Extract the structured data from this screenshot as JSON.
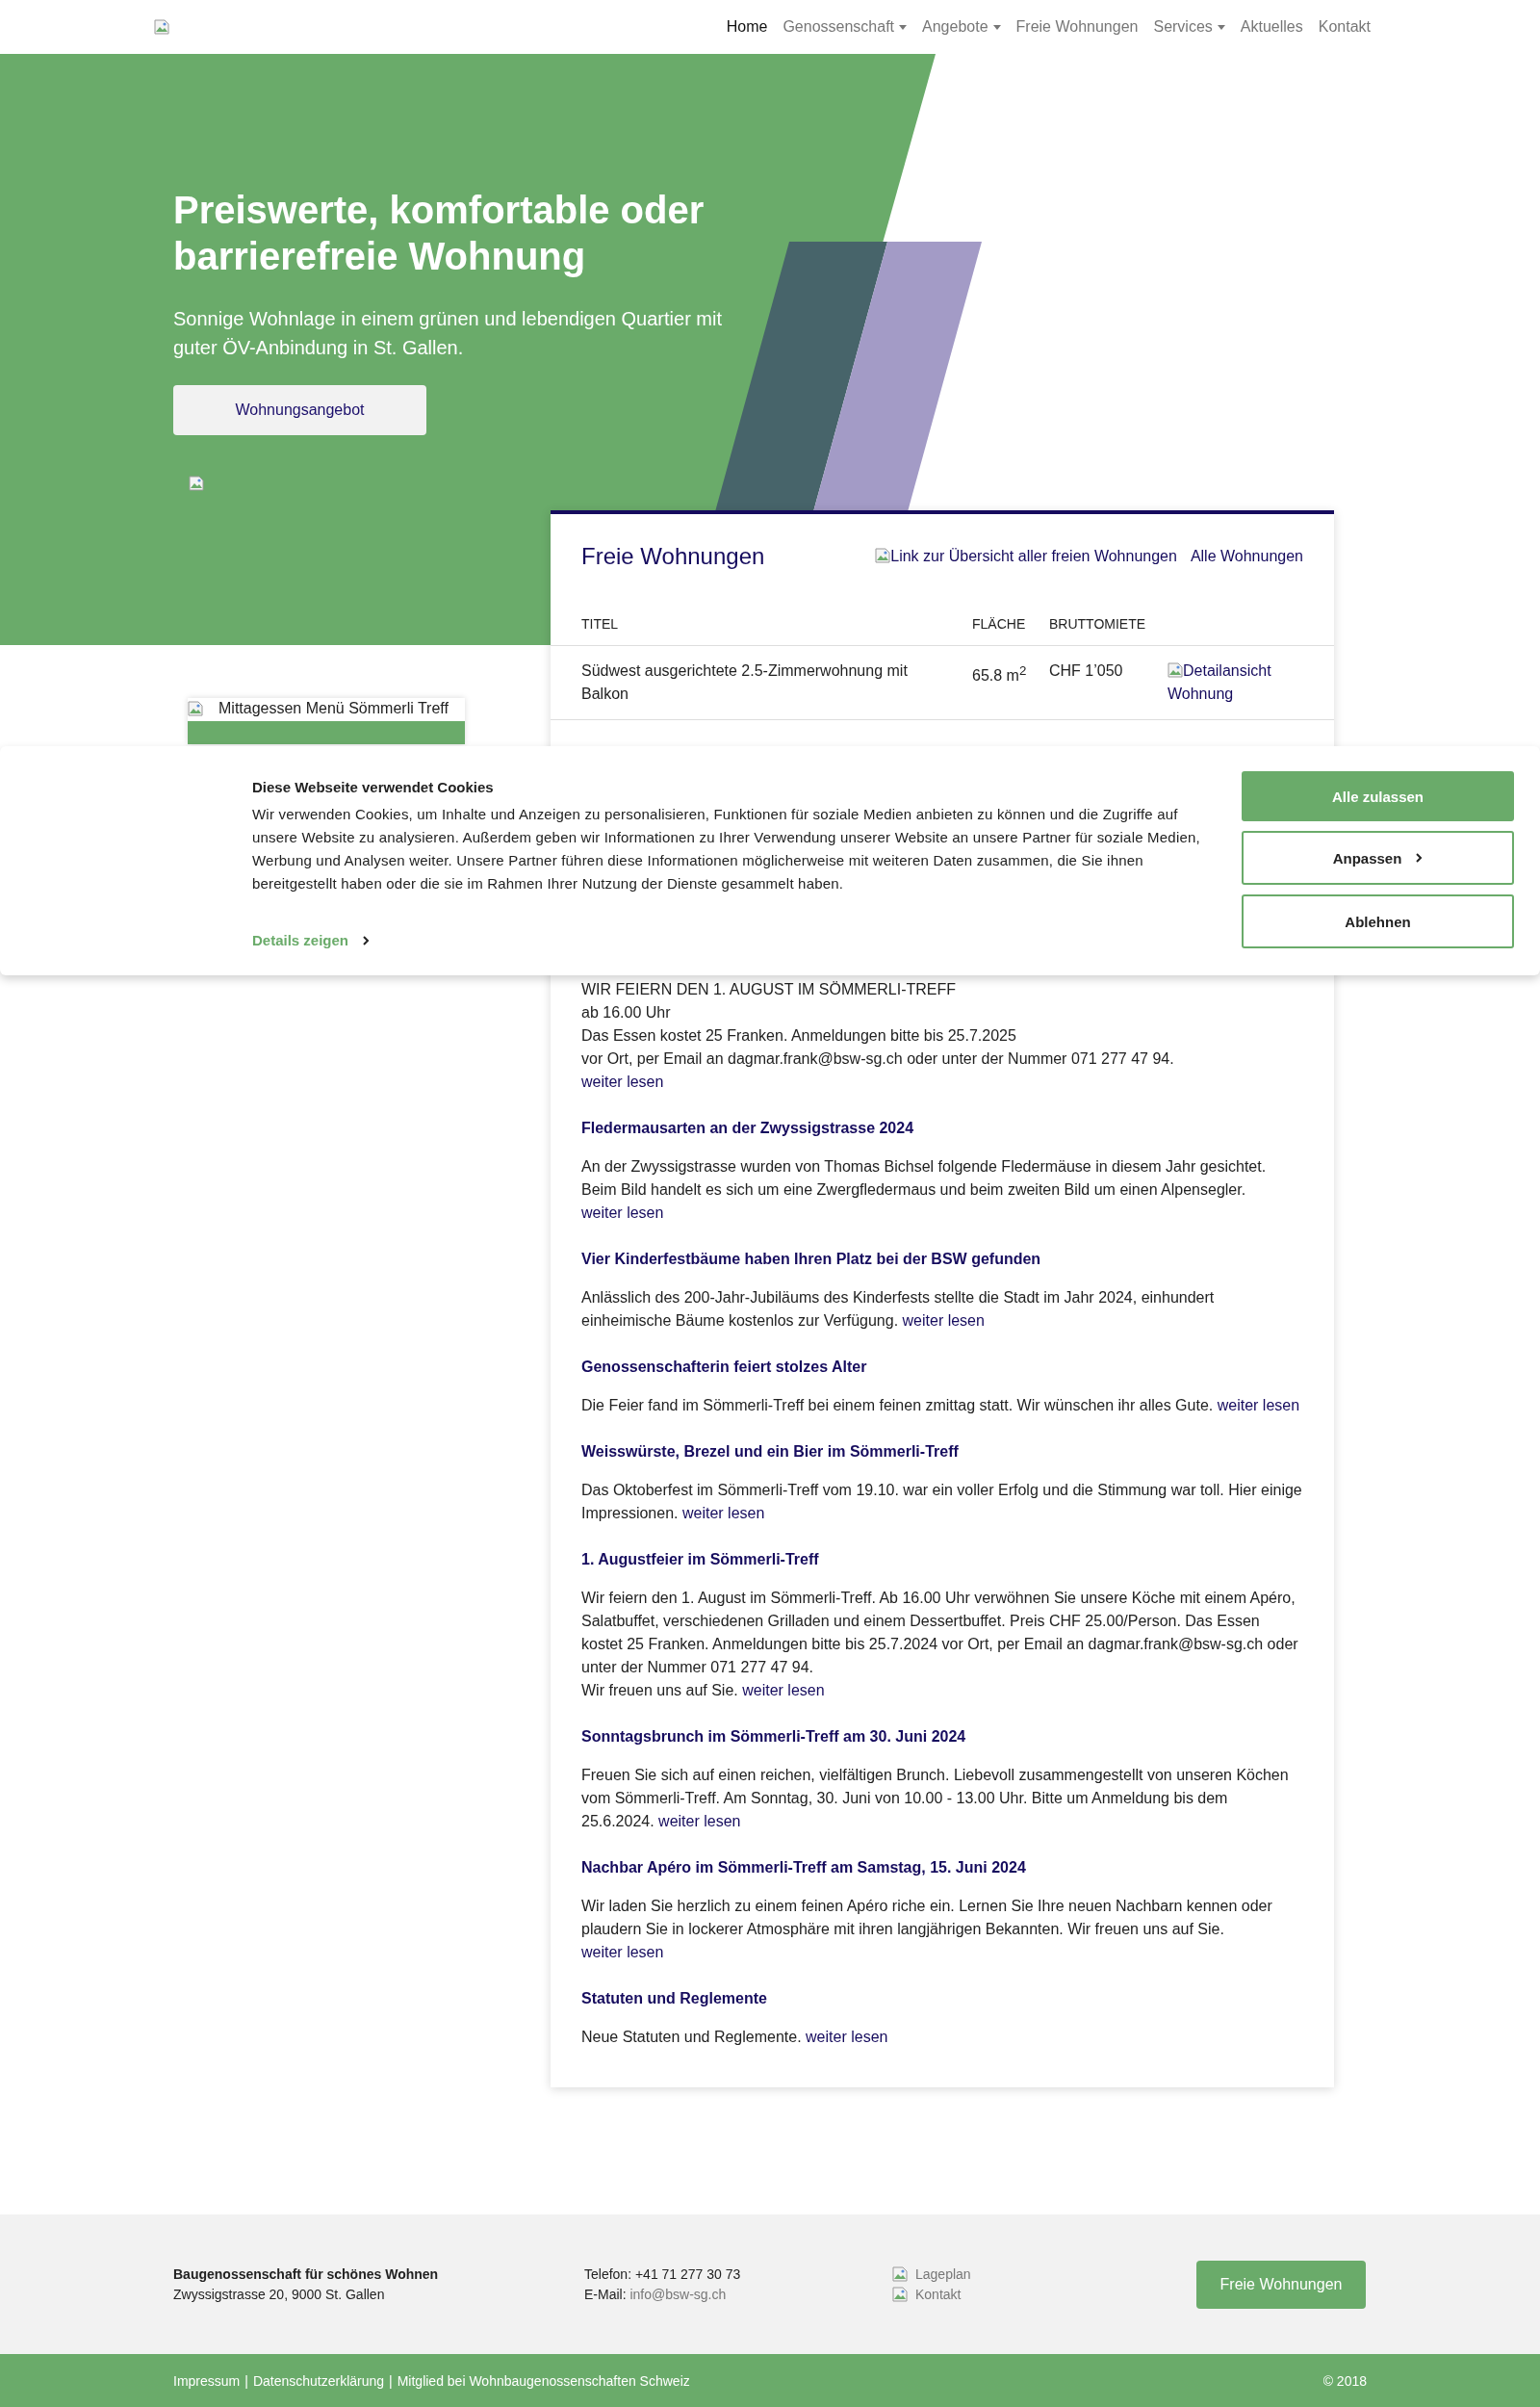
{
  "nav": {
    "items": [
      {
        "label": "Home",
        "selected": true,
        "dropdown": false
      },
      {
        "label": "Genossenschaft",
        "selected": false,
        "dropdown": true
      },
      {
        "label": "Angebote",
        "selected": false,
        "dropdown": true
      },
      {
        "label": "Freie Wohnungen",
        "selected": false,
        "dropdown": false
      },
      {
        "label": "Services",
        "selected": false,
        "dropdown": true
      },
      {
        "label": "Aktuelles",
        "selected": false,
        "dropdown": false
      },
      {
        "label": "Kontakt",
        "selected": false,
        "dropdown": false
      }
    ]
  },
  "hero": {
    "title": "Preiswerte, komfortable oder barrierefreie Wohnung",
    "subtitle": "Sonnige Wohnlage in einem grünen und lebendigen Quartier mit guter ÖV-Anbindung in St. Gallen.",
    "button": "Wohnungsangebot"
  },
  "side_card": {
    "image_alt": "Mittagessen Menü Sömmerli Treff"
  },
  "apartments": {
    "title": "Freie Wohnungen",
    "overview_image_alt": "Link zur Übersicht aller freien Wohnungen",
    "overview_link": "Alle Wohnungen",
    "columns": [
      "TITEL",
      "FLÄCHE",
      "BRUTTOMIETE"
    ],
    "rows": [
      {
        "title": "Südwest ausgerichtete 2.5-Zimmerwohnung mit Balkon",
        "area": "65.8 m$^{2}$",
        "rent": "CHF 1’050",
        "detail_image_alt": "Detailansicht Wohnung"
      }
    ]
  },
  "news": [
    {
      "lines": [
        "WIR FEIERN DEN 1. AUGUST IM SÖMMERLI-TREFF",
        "ab 16.00 Uhr",
        "Das Essen kostet 25 Franken. Anmeldungen bitte bis 25.7.2025",
        "vor Ort, per Email an dagmar.frank@bsw-sg.ch oder unter der Nummer 071 277 47 94."
      ],
      "link": "weiter lesen",
      "kind": "notice"
    },
    {
      "title": "Fledermausarten an der Zwyssigstrasse 2024",
      "lines": [
        "An der Zwyssigstrasse wurden von Thomas Bichsel folgende Fledermäuse in diesem Jahr gesichtet. Beim Bild handelt es sich um eine Zwergfledermaus und beim zweiten Bild um einen Alpensegler."
      ],
      "link": "weiter lesen",
      "kind": "article"
    },
    {
      "title": "Vier Kinderfestbäume haben Ihren Platz bei der BSW gefunden",
      "lines": [
        "Anlässlich des 200-Jahr-Jubiläums des Kinderfests stellte die Stadt im Jahr 2024, einhundert einheimische Bäume kostenlos zur Verfügung."
      ],
      "link": "weiter lesen",
      "kind": "article"
    },
    {
      "title": "Genossenschafterin feiert stolzes Alter",
      "lines": [
        "Die Feier fand im Sömmerli-Treff bei einem feinen zmittag statt. Wir wünschen ihr alles Gute."
      ],
      "link": "weiter lesen",
      "kind": "article"
    },
    {
      "title": "Weisswürste, Brezel und ein Bier im Sömmerli-Treff",
      "lines": [
        "Das Oktoberfest im Sömmerli-Treff vom 19.10. war ein voller Erfolg und die Stimmung war toll. Hier einige Impressionen."
      ],
      "link": "weiter lesen",
      "kind": "article"
    },
    {
      "title": "1. Augustfeier im Sömmerli-Treff",
      "lines": [
        "Wir feiern den 1. August im Sömmerli-Treff. Ab 16.00 Uhr verwöhnen Sie unsere Köche mit einem Apéro, Salatbuffet, verschiedenen Grilladen und einem Dessertbuffet. Preis CHF 25.00/Person. Das Essen kostet 25 Franken. Anmeldungen bitte bis 25.7.2024 vor Ort, per Email an dagmar.frank@bsw-sg.ch oder unter der Nummer 071 277 47 94.",
        "Wir freuen uns auf Sie."
      ],
      "link": "weiter lesen",
      "kind": "article"
    },
    {
      "title": "Sonntagsbrunch im Sömmerli-Treff am 30. Juni 2024",
      "lines": [
        "Freuen Sie sich auf einen reichen, vielfältigen Brunch. Liebevoll zusammengestellt von unseren Köchen vom Sömmerli-Treff. Am Sonntag, 30. Juni von 10.00 - 13.00 Uhr. Bitte um Anmeldung bis dem 25.6.2024."
      ],
      "link": "weiter lesen",
      "kind": "article"
    },
    {
      "title": "Nachbar Apéro im Sömmerli-Treff am Samstag, 15. Juni 2024",
      "lines": [
        "Wir laden Sie herzlich zu einem feinen Apéro riche ein. Lernen Sie Ihre neuen Nachbarn kennen oder plaudern Sie in lockerer Atmosphäre mit ihren langjährigen Bekannten. Wir freuen uns auf Sie."
      ],
      "link": "weiter lesen",
      "kind": "article"
    },
    {
      "title": "Statuten und Reglemente",
      "lines": [
        "Neue Statuten und Reglemente."
      ],
      "link": "weiter lesen",
      "kind": "article"
    }
  ],
  "cookie_banner": {
    "title": "Diese Webseite verwendet Cookies",
    "text": "Wir verwenden Cookies, um Inhalte und Anzeigen zu personalisieren, Funktionen für soziale Medien anbieten zu können und die Zugriffe auf unsere Website zu analysieren. Außerdem geben wir Informationen zu Ihrer Verwendung unserer Website an unsere Partner für soziale Medien, Werbung und Analysen weiter. Unsere Partner führen diese Informationen möglicherweise mit weiteren Daten zusammen, die Sie ihnen bereitgestellt haben oder die sie im Rahmen Ihrer Nutzung der Dienste gesammelt haben.",
    "details_link": "Details zeigen",
    "buttons": [
      {
        "label": "Alle zulassen",
        "kind": "primary"
      },
      {
        "label": "Anpassen",
        "kind": "chevron"
      },
      {
        "label": "Ablehnen",
        "kind": "outline"
      }
    ]
  },
  "footer": {
    "org_name": "Baugenossenschaft für schönes Wohnen",
    "address": "Zwyssigstrasse 20, 9000 St. Gallen",
    "phone": "Telefon: +41 71 277 30 73",
    "email_label": "E-Mail:",
    "email": "info@bsw-sg.ch",
    "links": [
      "Lageplan",
      "Kontakt"
    ],
    "button": "Freie Wohnungen",
    "bottom_links": [
      "Impressum",
      "Datenschutzerklärung",
      "Mitglied bei Wohnbaugenossenschaften Schweiz"
    ],
    "separator": "|",
    "copyright": "© 2018"
  }
}
